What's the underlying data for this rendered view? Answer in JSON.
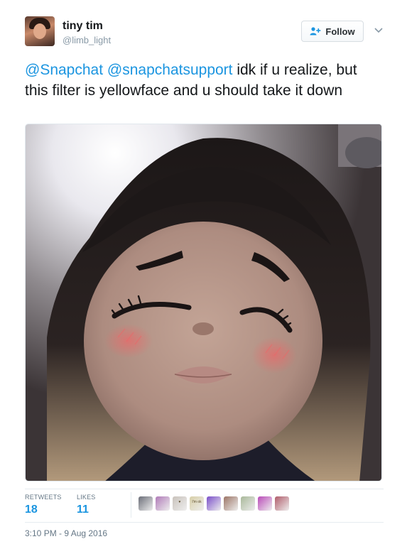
{
  "user": {
    "display_name": "tiny tim",
    "handle": "@limb_light",
    "avatar_icon": "profile-photo"
  },
  "follow_button": {
    "label": "Follow",
    "icon": "add-user-icon"
  },
  "more_menu_icon": "chevron-down-icon",
  "tweet": {
    "mention_1": "@Snapchat",
    "mention_2": "@snapchatsupport",
    "body": " idk if u realize, but this filter is yellowface and u should take it down"
  },
  "media": {
    "type": "photo"
  },
  "stats": {
    "retweets_label": "RETWEETS",
    "retweets_count": "18",
    "likes_label": "LIKES",
    "likes_count": "11"
  },
  "likers": [
    {
      "name": "liker-1",
      "color": "#6b6e78"
    },
    {
      "name": "liker-2",
      "color": "#b07ab8"
    },
    {
      "name": "liker-3",
      "color": "#c9c2bb",
      "text": "♥"
    },
    {
      "name": "liker-4",
      "color": "#d8cfa8",
      "text": "I'm ok"
    },
    {
      "name": "liker-5",
      "color": "#7a4fc9"
    },
    {
      "name": "liker-6",
      "color": "#9c7465"
    },
    {
      "name": "liker-7",
      "color": "#a9b89a"
    },
    {
      "name": "liker-8",
      "color": "#b94bb8"
    },
    {
      "name": "liker-9",
      "color": "#b05c6a"
    }
  ],
  "timestamp": "3:10 PM - 9 Aug 2016",
  "colors": {
    "link": "#1b95e0",
    "text": "#14171a",
    "muted": "#657786"
  }
}
